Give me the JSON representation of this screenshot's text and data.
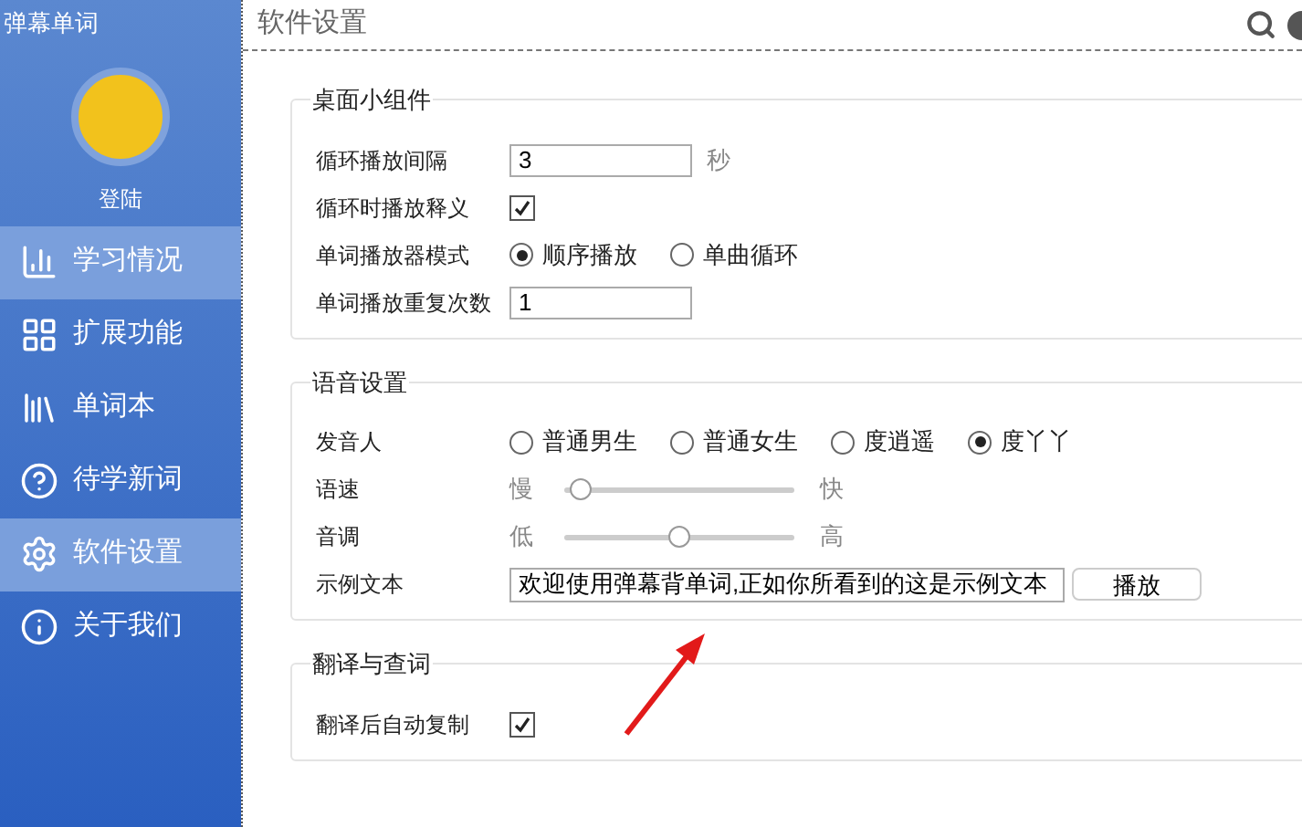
{
  "app_title": "弹幕单词",
  "login": "登陆",
  "nav": [
    {
      "label": "学习情况",
      "selected": true
    },
    {
      "label": "扩展功能",
      "selected": false
    },
    {
      "label": "单词本",
      "selected": false
    },
    {
      "label": "待学新词",
      "selected": false
    },
    {
      "label": "软件设置",
      "selected": true
    },
    {
      "label": "关于我们",
      "selected": false
    }
  ],
  "page_title": "软件设置",
  "groups": [
    {
      "title": "桌面小组件",
      "rows": [
        {
          "kind": "input",
          "label": "循环播放间隔",
          "value": "3",
          "unit": "秒"
        },
        {
          "kind": "checkbox",
          "label": "循环时播放释义",
          "checked": true
        },
        {
          "kind": "radio",
          "label": "单词播放器模式",
          "options": [
            {
              "label": "顺序播放",
              "selected": true
            },
            {
              "label": "单曲循环",
              "selected": false
            }
          ]
        },
        {
          "kind": "input",
          "label": "单词播放重复次数",
          "value": "1"
        }
      ]
    },
    {
      "title": "语音设置",
      "rows": [
        {
          "kind": "radio",
          "label": "发音人",
          "options": [
            {
              "label": "普通男生",
              "selected": false
            },
            {
              "label": "普通女生",
              "selected": false
            },
            {
              "label": "度逍遥",
              "selected": false
            },
            {
              "label": "度丫丫",
              "selected": true
            }
          ]
        },
        {
          "kind": "slider",
          "label": "语速",
          "min_label": "慢",
          "max_label": "快",
          "level": 0.07
        },
        {
          "kind": "slider",
          "label": "音调",
          "min_label": "低",
          "max_label": "高",
          "level": 0.5
        },
        {
          "kind": "text",
          "label": "示例文本",
          "value": "欢迎使用弹幕背单词,正如你所看到的这是示例文本",
          "button": "播放"
        }
      ]
    },
    {
      "title": "翻译与查词",
      "rows": [
        {
          "kind": "checkbox",
          "label": "翻译后自动复制",
          "checked": true
        }
      ]
    }
  ]
}
